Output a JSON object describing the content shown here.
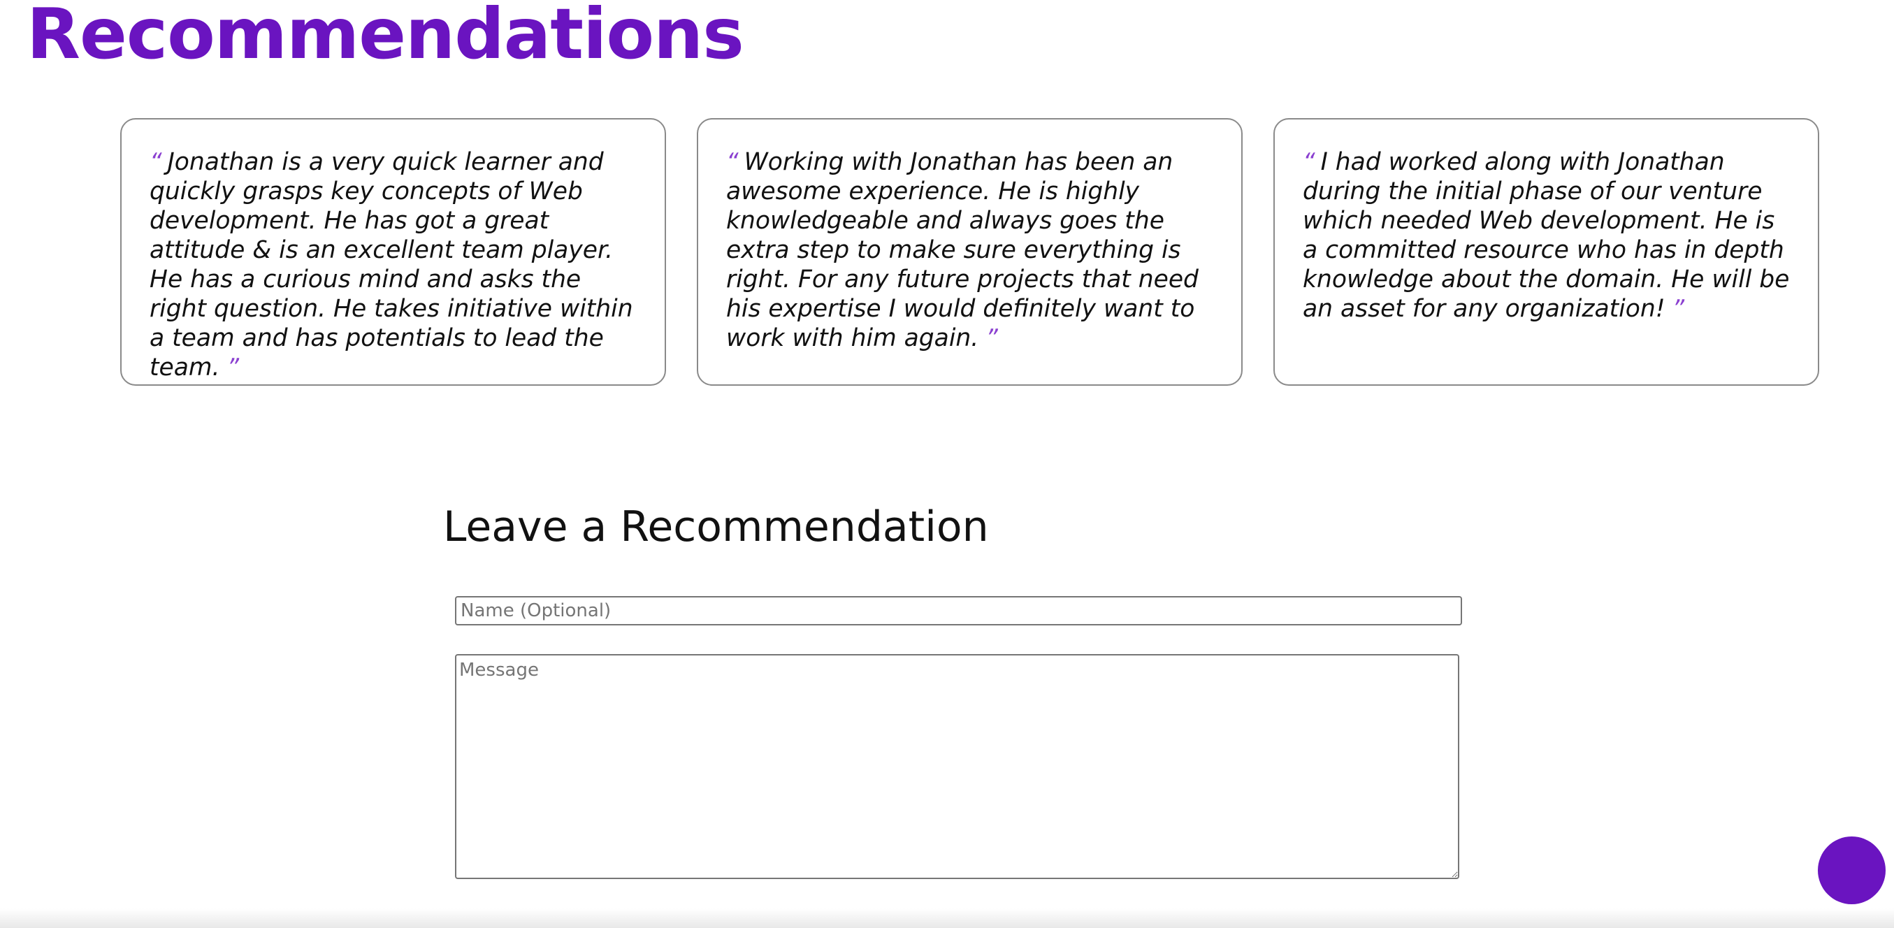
{
  "section": {
    "title": "Recommendations"
  },
  "quote_marks": {
    "open": "“",
    "close": "”"
  },
  "recommendations": [
    {
      "text": "Jonathan is a very quick learner and quickly grasps key concepts of Web development. He has got a great attitude & is an excellent team player. He has a curious mind and asks the right question. He takes initiative within a team and has potentials to lead the team."
    },
    {
      "text": "Working with Jonathan has been an awesome experience. He is highly knowledgeable and always goes the extra step to make sure everything is right. For any future projects that need his expertise I would definitely want to work with him again."
    },
    {
      "text": "I had worked along with Jonathan during the initial phase of our venture which needed Web development. He is a committed resource who has in depth knowledge about the domain. He will be an asset for any organization!"
    }
  ],
  "form": {
    "heading": "Leave a Recommendation",
    "name_placeholder": "Name (Optional)",
    "name_value": "",
    "message_placeholder": "Message",
    "message_value": ""
  },
  "colors": {
    "accent": "#6a14c0",
    "quote_mark": "#8a3fd0",
    "card_border": "#8a8a8a"
  }
}
